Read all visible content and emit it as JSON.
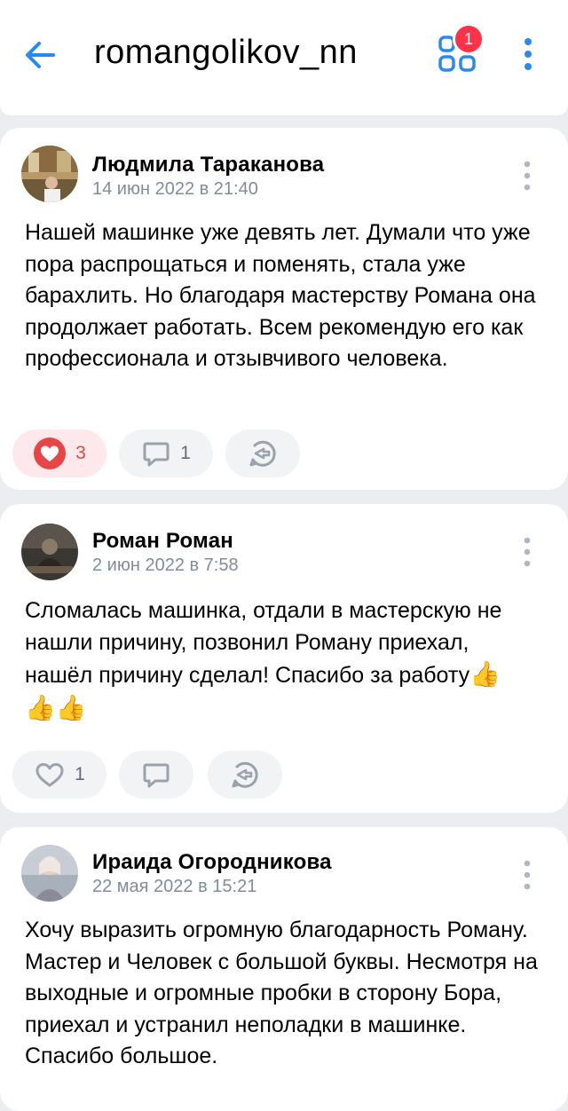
{
  "header": {
    "title": "romangolikov_nn",
    "apps_badge": "1"
  },
  "posts": [
    {
      "author": "Людмила Тараканова",
      "date": "14 июн 2022 в 21:40",
      "text": "Нашей машинке уже девять лет. Думали что уже пора распрощаться и поменять, стала уже барахлить. Но благодаря мастерству Романа она продолжает работать. Всем рекомендую его как профессионала и отзывчивого человека.",
      "likes": "3",
      "liked": true,
      "comments": "1"
    },
    {
      "author": "Роман Роман",
      "date": "2 июн 2022 в 7:58",
      "text_line1": "Сломалась машинка, отдали в мастерскую не",
      "text_line2": "нашли причину, позвонил Роману приехал,",
      "text_line3": "нашёл причину сделал! Спасибо за работу",
      "thumbs": "👍",
      "likes": "1",
      "liked": false,
      "comments": ""
    },
    {
      "author": "Ираида Огородникова",
      "date": "22 мая 2022 в 15:21",
      "text": "Хочу выразить огромную благодарность Роману. Мастер и Человек с большой буквы. Несмотря на выходные и огромные пробки в сторону Бора, приехал и устранил неполадки в машинке. Спасибо большое."
    }
  ],
  "colors": {
    "accent": "#2a88f5",
    "like_red": "#e64646",
    "secondary_text": "#818c99",
    "badge": "#ff3347"
  }
}
